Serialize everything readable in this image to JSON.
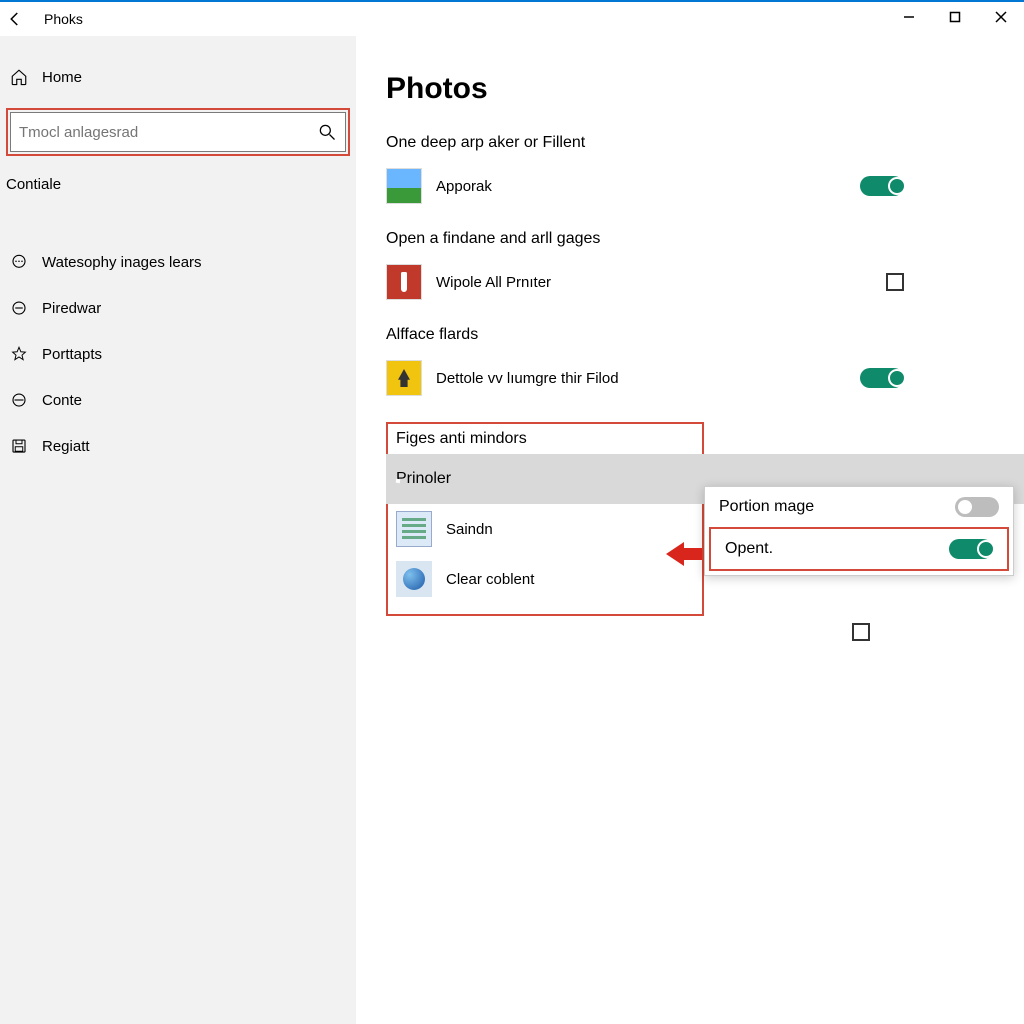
{
  "titlebar": {
    "app_name": "Phoks"
  },
  "sidebar": {
    "home_label": "Home",
    "search_placeholder": "Tmocl anlagesrad",
    "contiale_label": "Contiale",
    "items": [
      {
        "label": "Watesophy inages lears"
      },
      {
        "label": "Piredwar"
      },
      {
        "label": "Porttapts"
      },
      {
        "label": "Conte"
      },
      {
        "label": "Regiatt"
      }
    ]
  },
  "main": {
    "heading": "Photos",
    "sections": [
      {
        "title": "One deep arp aker or Fillent",
        "item_label": "Apporak",
        "toggle": "on"
      },
      {
        "title": "Open a findane and arll gages",
        "item_label": "Wipole All Prnıter",
        "toggle": "checkbox-off"
      },
      {
        "title": "Alfface flards",
        "item_label": "Dettole vv lıumgre thir Filod",
        "toggle": "on"
      }
    ],
    "figes_title": "Figes anti mindors",
    "figes_items": [
      {
        "label": "Prinoler",
        "toggle": "checkbox-off",
        "selected": true
      },
      {
        "label": "Saindn"
      },
      {
        "label": "Clear coblent",
        "toggle": "checkbox-off"
      }
    ]
  },
  "popup": {
    "row1_label": "Portion mage",
    "row1_toggle": "off",
    "row2_label": "Opent.",
    "row2_toggle": "on"
  }
}
